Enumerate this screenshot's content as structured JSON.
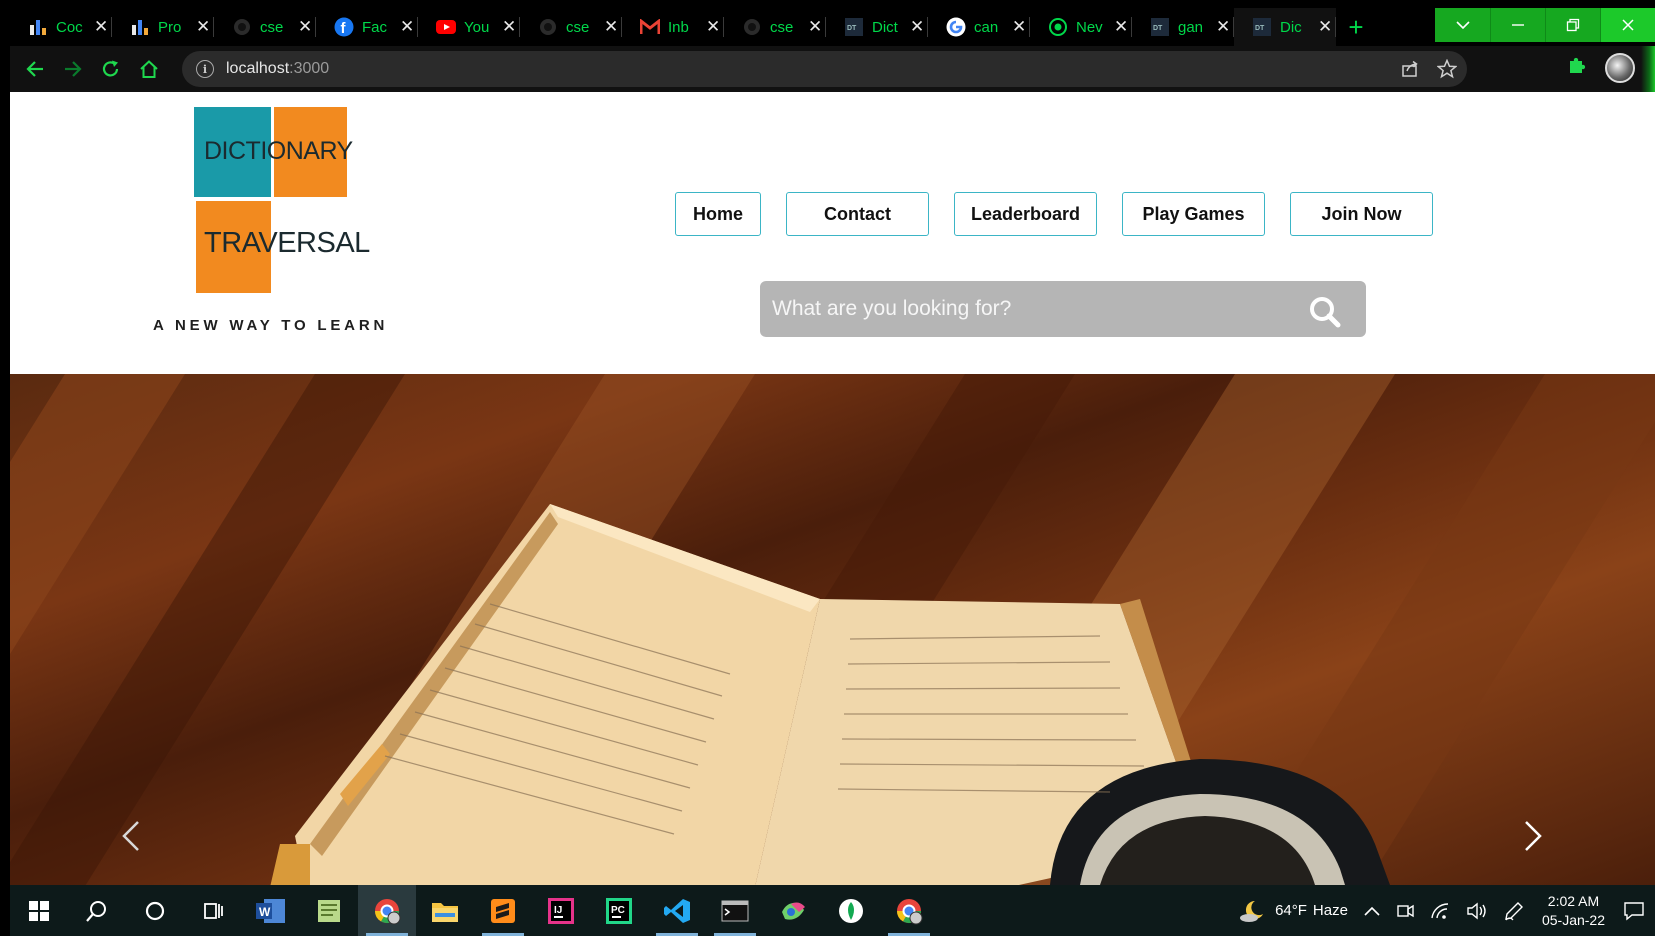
{
  "browser": {
    "tabs": [
      {
        "title": "Coc",
        "icon": "bar-chart-icon"
      },
      {
        "title": "Pro",
        "icon": "bar-chart-icon"
      },
      {
        "title": "cse",
        "icon": "github-icon"
      },
      {
        "title": "Fac",
        "icon": "facebook-icon"
      },
      {
        "title": "You",
        "icon": "youtube-icon"
      },
      {
        "title": "cse",
        "icon": "github-icon"
      },
      {
        "title": "Inb",
        "icon": "gmail-icon"
      },
      {
        "title": "cse",
        "icon": "github-icon"
      },
      {
        "title": "Dict",
        "icon": "dt-icon"
      },
      {
        "title": "can",
        "icon": "google-icon"
      },
      {
        "title": "Nev",
        "icon": "chrome-new-tab-icon"
      },
      {
        "title": "gan",
        "icon": "dt-icon"
      },
      {
        "title": "Dic",
        "icon": "dt-icon",
        "active": true
      }
    ],
    "url_host": "localhost",
    "url_port": ":3000"
  },
  "site": {
    "logo_word1_a": "DICTI",
    "logo_word1_b": "ONARY",
    "logo_word2_a": "TRAV",
    "logo_word2_b": "ERSAL",
    "tagline": "A NEW WAY TO LEARN",
    "nav": {
      "home": "Home",
      "contact": "Contact",
      "leaderboard": "Leaderboard",
      "play_games": "Play Games",
      "join_now": "Join Now"
    },
    "search_placeholder": "What are you looking for?"
  },
  "taskbar": {
    "weather_temp": "64°F",
    "weather_desc": "Haze",
    "time": "2:02 AM",
    "date": "05-Jan-22"
  },
  "colors": {
    "accent_green": "#00d84a",
    "logo_teal": "#1a9aa8",
    "logo_orange": "#f28a1f",
    "nav_border": "#3bb5c6"
  }
}
